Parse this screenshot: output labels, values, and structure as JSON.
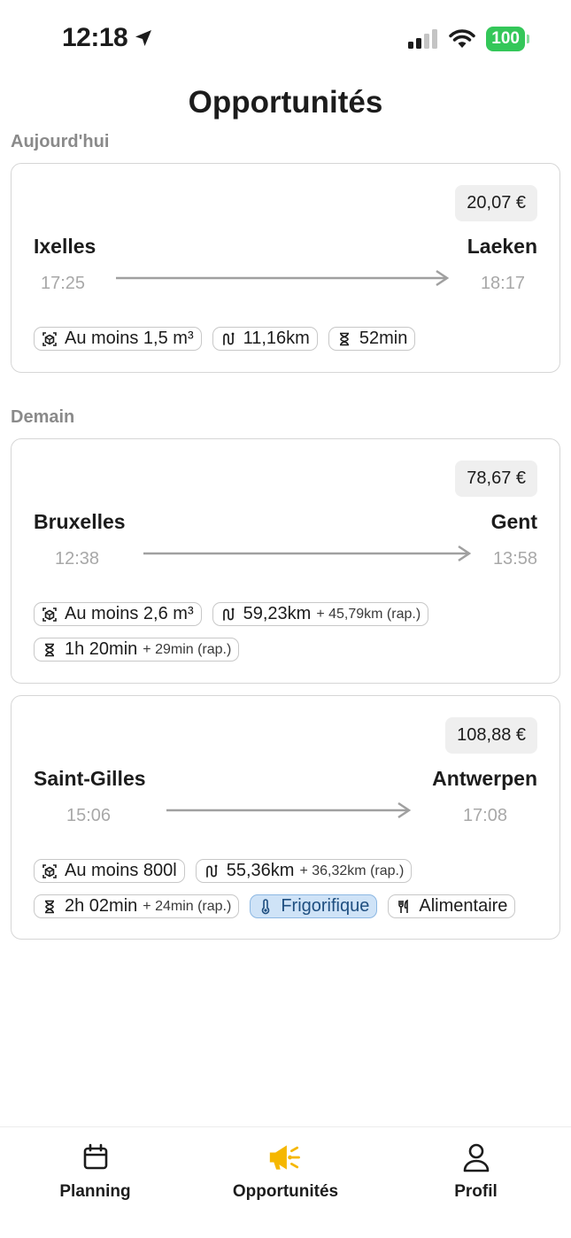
{
  "status_bar": {
    "time": "12:18",
    "battery": "100"
  },
  "page_title": "Opportunités",
  "sections": [
    {
      "label": "Aujourd'hui"
    },
    {
      "label": "Demain"
    }
  ],
  "cards": [
    {
      "price": "20,07 €",
      "from_city": "Ixelles",
      "to_city": "Laeken",
      "depart_time": "17:25",
      "arrive_time": "18:17",
      "tags": [
        {
          "icon": "box-icon",
          "label": "Au moins 1,5 m³",
          "extra": ""
        },
        {
          "icon": "route-icon",
          "label": "11,16km",
          "extra": ""
        },
        {
          "icon": "hourglass-icon",
          "label": "52min",
          "extra": ""
        }
      ]
    },
    {
      "price": "78,67 €",
      "from_city": "Bruxelles",
      "to_city": "Gent",
      "depart_time": "12:38",
      "arrive_time": "13:58",
      "tags": [
        {
          "icon": "box-icon",
          "label": "Au moins 2,6 m³",
          "extra": ""
        },
        {
          "icon": "route-icon",
          "label": "59,23km",
          "extra": "+ 45,79km (rap.)"
        },
        {
          "icon": "hourglass-icon",
          "label": "1h 20min",
          "extra": "+ 29min (rap.)"
        }
      ]
    },
    {
      "price": "108,88 €",
      "from_city": "Saint-Gilles",
      "to_city": "Antwerpen",
      "depart_time": "15:06",
      "arrive_time": "17:08",
      "tags": [
        {
          "icon": "box-icon",
          "label": "Au moins 800l",
          "extra": ""
        },
        {
          "icon": "route-icon",
          "label": "55,36km",
          "extra": "+ 36,32km (rap.)"
        },
        {
          "icon": "hourglass-icon",
          "label": "2h 02min",
          "extra": "+ 24min (rap.)"
        },
        {
          "icon": "thermometer-icon",
          "label": "Frigorifique",
          "extra": ""
        },
        {
          "icon": "utensils-icon",
          "label": "Alimentaire",
          "extra": ""
        }
      ]
    }
  ],
  "bottom_nav": [
    {
      "label": "Planning",
      "icon": "calendar-icon",
      "active": false
    },
    {
      "label": "Opportunités",
      "icon": "megaphone-icon",
      "active": true
    },
    {
      "label": "Profil",
      "icon": "user-icon",
      "active": false
    }
  ],
  "colors": {
    "accent": "#f5b700",
    "cold_tag_bg": "#cfe3f7",
    "battery": "#34c759"
  }
}
